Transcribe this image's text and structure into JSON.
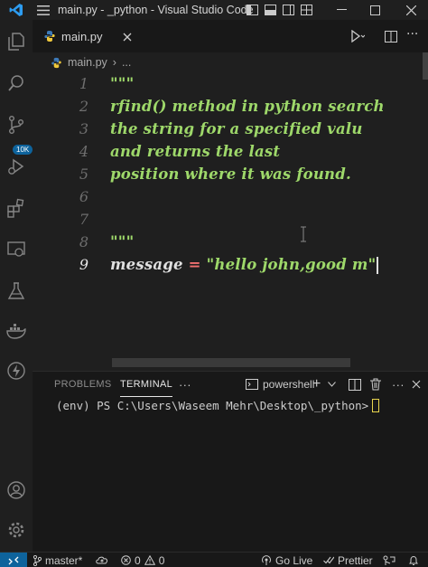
{
  "window": {
    "title": "main.py - _python - Visual Studio Code"
  },
  "activity": {
    "source_control_badge": "10K"
  },
  "editor": {
    "tab_label": "main.py",
    "breadcrumb": {
      "file": "main.py",
      "more": "..."
    },
    "lines": [
      {
        "number": "1",
        "text": "\"\"\""
      },
      {
        "number": "2",
        "text": "rfind() method in python search"
      },
      {
        "number": "3",
        "text": "the string for a specified valu"
      },
      {
        "number": "4",
        "text": "and returns the last"
      },
      {
        "number": "5",
        "text": "position where it was found."
      },
      {
        "number": "6",
        "text": ""
      },
      {
        "number": "7",
        "text": ""
      },
      {
        "number": "8",
        "text": "\"\"\""
      },
      {
        "number": "9",
        "tokens": {
          "var": "message",
          "op": "=",
          "str": "\"hello john,good m\""
        }
      }
    ]
  },
  "panel": {
    "tabs": {
      "problems": "PROBLEMS",
      "terminal": "TERMINAL",
      "more": "···"
    },
    "shell_name": "powershell",
    "terminal_prompt": "(env) PS C:\\Users\\Waseem Mehr\\Desktop\\_python>"
  },
  "status": {
    "branch": "master*",
    "errors": "0",
    "warnings": "0",
    "go_live": "Go Live",
    "prettier": "Prettier"
  },
  "colors": {
    "accent": "#0e639c",
    "comment_green": "#9ed86a",
    "operator_red": "#f07070",
    "cursor_yellow": "#e8d44d"
  }
}
